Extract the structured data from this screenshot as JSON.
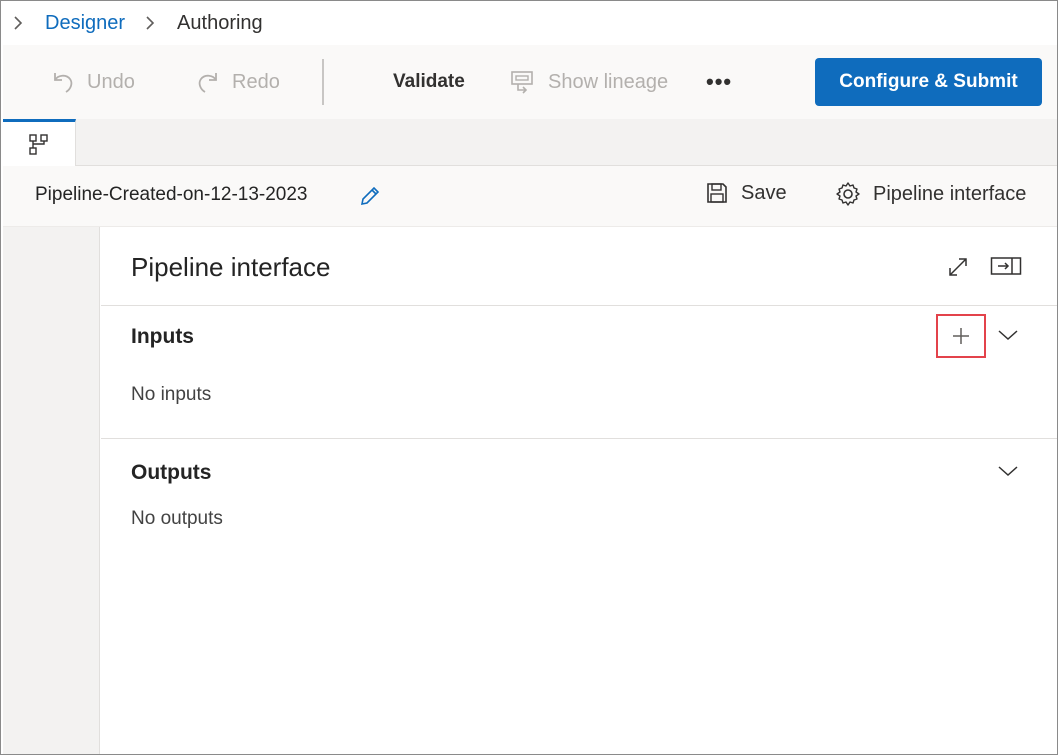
{
  "breadcrumb": {
    "items": [
      "Designer",
      "Authoring"
    ]
  },
  "toolbar": {
    "undo_label": "Undo",
    "redo_label": "Redo",
    "validate_label": "Validate",
    "lineage_label": "Show lineage",
    "more_label": "•••",
    "submit_label": "Configure & Submit"
  },
  "pipeline": {
    "name": "Pipeline-Created-on-12-13-2023",
    "save_label": "Save",
    "interface_label": "Pipeline interface"
  },
  "panel": {
    "title": "Pipeline interface",
    "inputs": {
      "title": "Inputs",
      "empty_text": "No inputs"
    },
    "outputs": {
      "title": "Outputs",
      "empty_text": "No outputs"
    }
  },
  "colors": {
    "accent": "#0f6cbd",
    "highlight": "#e3434b"
  },
  "icons": [
    "chevron-right-icon",
    "undo-icon",
    "redo-icon",
    "lineage-icon",
    "more-icon",
    "pipeline-graph-icon",
    "pencil-icon",
    "save-icon",
    "gear-icon",
    "expand-icon",
    "dock-panel-icon",
    "plus-icon",
    "chevron-down-icon"
  ]
}
